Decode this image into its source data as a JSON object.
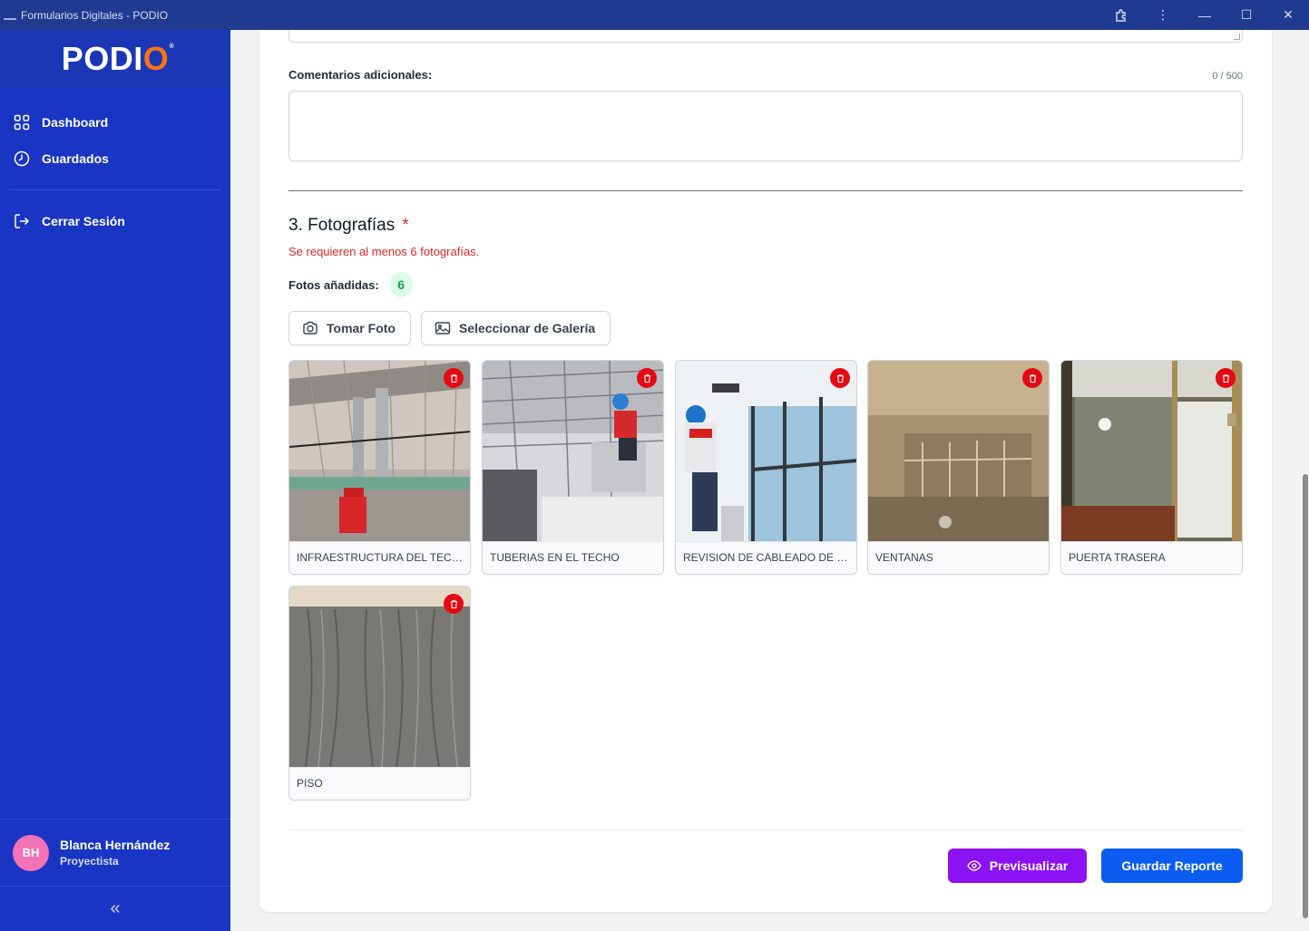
{
  "window": {
    "title": "Formularios Digitales - PODIO"
  },
  "brand": {
    "logo_main": "PODI",
    "logo_o": "O",
    "logo_mark": "®"
  },
  "sidebar": {
    "items": [
      {
        "label": "Dashboard",
        "icon": "grid-icon"
      },
      {
        "label": "Guardados",
        "icon": "clock-icon"
      }
    ],
    "logout_label": "Cerrar Sesión",
    "user": {
      "initials": "BH",
      "name": "Blanca Hernández",
      "role": "Proyectista"
    },
    "collapse_glyph": "«"
  },
  "form": {
    "comments": {
      "label": "Comentarios adicionales:",
      "counter": "0 / 500",
      "value": ""
    },
    "photos_section": {
      "title": "3. Fotografías",
      "required_mark": "*",
      "requirement_message": "Se requieren al menos 6 fotografías.",
      "count_label": "Fotos añadidas:",
      "count": "6",
      "take_photo_label": "Tomar Foto",
      "gallery_label": "Seleccionar de Galería",
      "photos": [
        {
          "caption": "INFRAESTRUCTURA DEL TECHO"
        },
        {
          "caption": "TUBERIAS EN EL TECHO"
        },
        {
          "caption": "REVISION DE CABLEADO DE LUC..."
        },
        {
          "caption": "VENTANAS"
        },
        {
          "caption": "PUERTA TRASERA"
        },
        {
          "caption": "PISO"
        }
      ]
    },
    "actions": {
      "preview_label": "Previsualizar",
      "save_label": "Guardar Reporte"
    }
  },
  "colors": {
    "sidebar": "#1a35c4",
    "titlebar": "#1f3a8f",
    "preview": "#8b12f2",
    "save": "#0b5cf0",
    "error": "#dc2626",
    "badge_bg": "#dcfce7",
    "badge_fg": "#16a34a",
    "delete": "#e50914"
  }
}
